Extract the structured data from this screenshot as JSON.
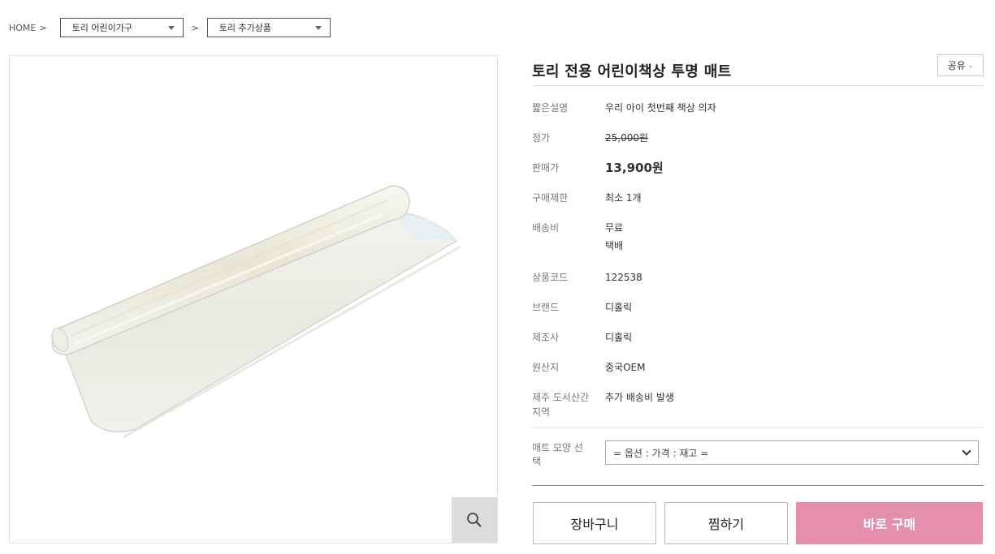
{
  "breadcrumb": {
    "home": "HOME",
    "sep": ">",
    "category1": "토리 어린이가구",
    "category2": "토리 추가상품"
  },
  "product": {
    "title": "토리 전용 어린이책상 투명 매트",
    "share_label": "공유",
    "share_chevron": "⌄"
  },
  "details": {
    "short_desc": {
      "label": "짧은설명",
      "value": "우리 아이 첫번째 책상 의자"
    },
    "list_price": {
      "label": "정가",
      "value": "25,000원"
    },
    "sale_price": {
      "label": "판매가",
      "value": "13,900원"
    },
    "purchase_limit": {
      "label": "구매제한",
      "value": "최소 1개"
    },
    "shipping": {
      "label": "배송비",
      "value": "무료",
      "method": "택배"
    },
    "product_code": {
      "label": "상품코드",
      "value": "122538"
    },
    "brand": {
      "label": "브랜드",
      "value": "디홀릭"
    },
    "manufacturer": {
      "label": "제조사",
      "value": "디홀릭"
    },
    "origin": {
      "label": "원산지",
      "value": "중국OEM"
    },
    "jeju": {
      "label_line1": "제주 도서산간",
      "label_line2": "지역",
      "value": "추가 배송비 발생"
    }
  },
  "option": {
    "label_line1": "매트 모양 선",
    "label_line2": "택",
    "selected": "= 옵션 : 가격 : 재고 ="
  },
  "actions": {
    "cart": "장바구니",
    "wishlist": "찜하기",
    "buy_now": "바로 구매"
  },
  "icons": {
    "zoom": "search-icon",
    "caret": "caret-down-icon",
    "select": "chevron-down-icon"
  },
  "colors": {
    "buy_button": "#e68fab"
  }
}
